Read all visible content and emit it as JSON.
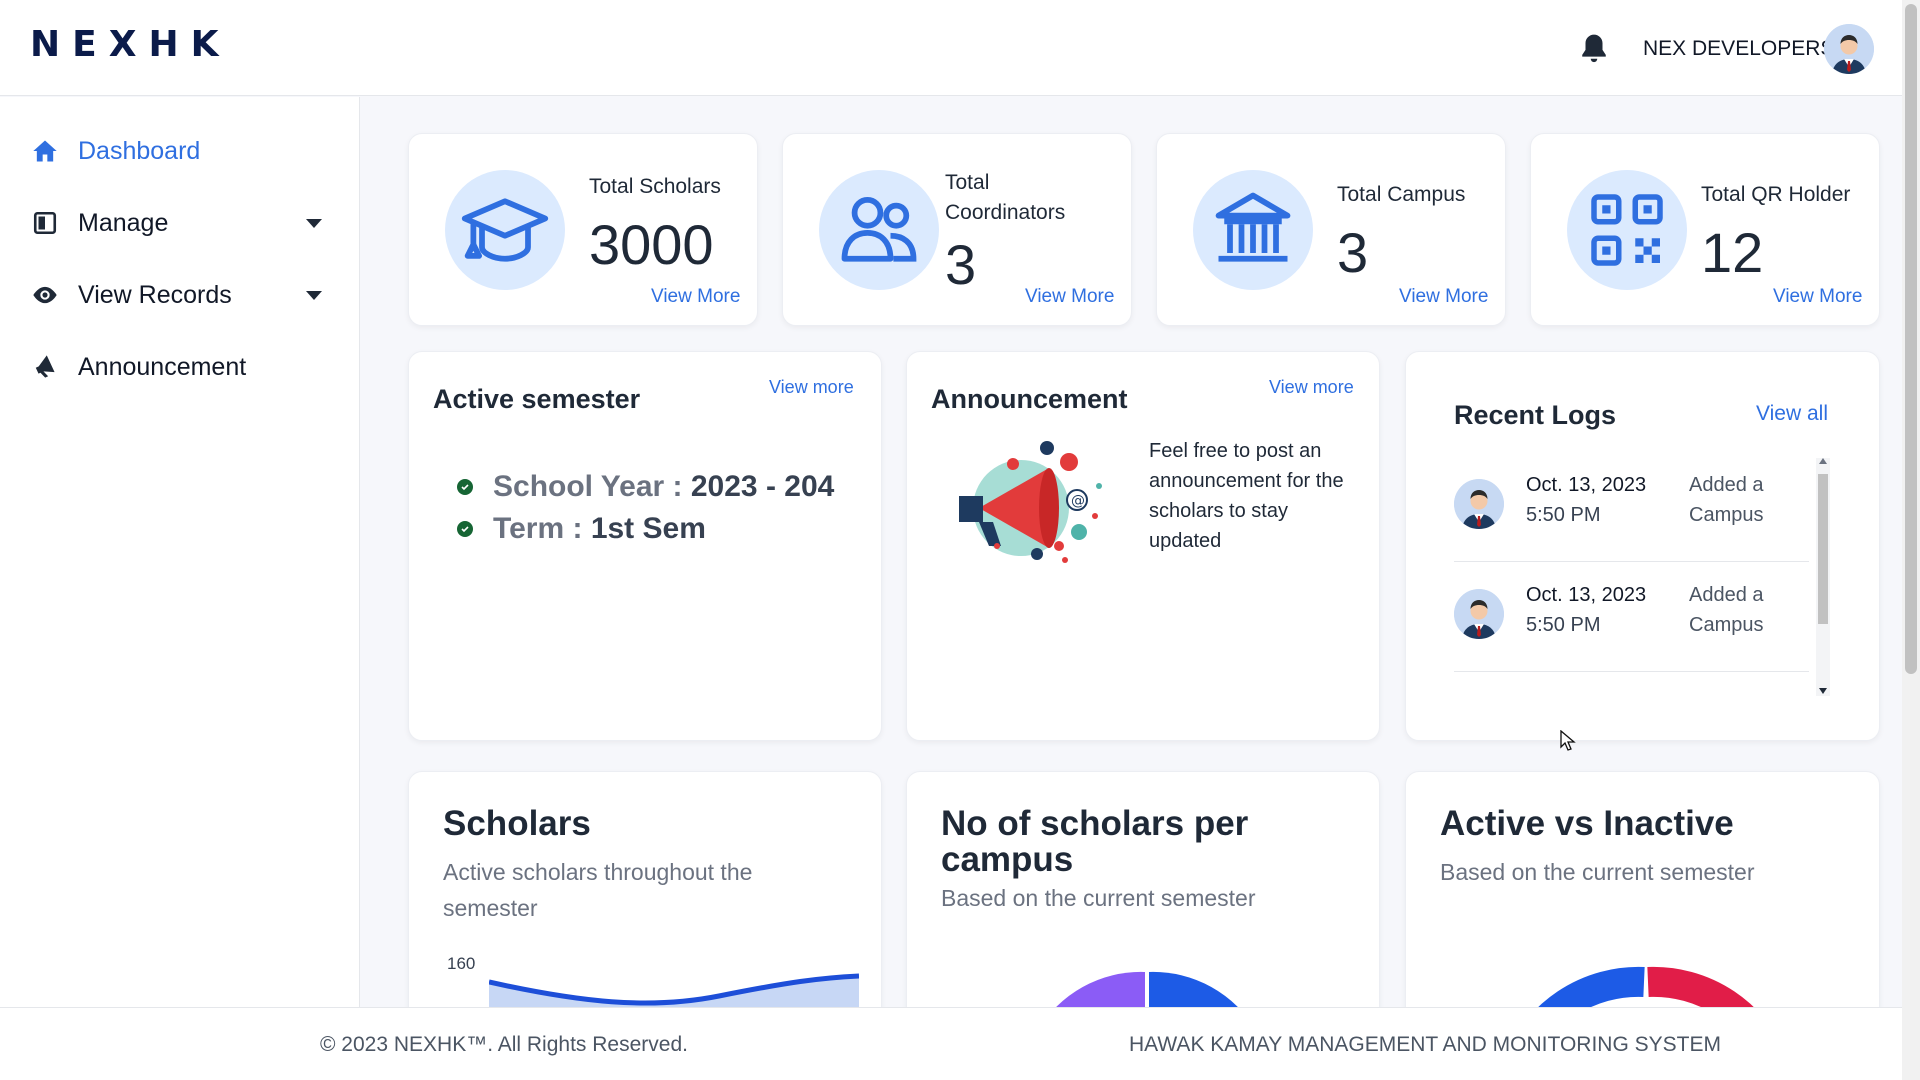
{
  "brand": {
    "logo": "NEXHK"
  },
  "header": {
    "user_name": "NEX DEVELOPERS"
  },
  "sidebar": {
    "items": [
      {
        "label": "Dashboard",
        "icon": "home-icon",
        "active": true
      },
      {
        "label": "Manage",
        "icon": "board-icon",
        "has_dropdown": true
      },
      {
        "label": "View Records",
        "icon": "eye-icon",
        "has_dropdown": true
      },
      {
        "label": "Announcement",
        "icon": "megaphone-icon"
      }
    ]
  },
  "stats": [
    {
      "label": "Total Scholars",
      "value": "3000",
      "link": "View More",
      "icon": "graduation-cap-icon"
    },
    {
      "label": "Total Coordinators",
      "value": "3",
      "link": "View More",
      "icon": "users-icon"
    },
    {
      "label": "Total Campus",
      "value": "3",
      "link": "View More",
      "icon": "building-icon"
    },
    {
      "label": "Total QR Holder",
      "value": "12",
      "link": "View More",
      "icon": "qr-code-icon"
    }
  ],
  "semester": {
    "title": "Active semester",
    "link": "View more",
    "school_year_label": "School Year :",
    "school_year_value": "2023 - 204",
    "term_label": "Term :",
    "term_value": "1st Sem"
  },
  "announcement": {
    "title": "Announcement",
    "link": "View more",
    "text": "Feel free to post an announcement for the scholars to stay updated",
    "image": "megaphone-illustration"
  },
  "logs": {
    "title": "Recent Logs",
    "link": "View all",
    "items": [
      {
        "date": "Oct. 13, 2023",
        "time": "5:50 PM",
        "action": "Added a Campus"
      },
      {
        "date": "Oct. 13, 2023",
        "time": "5:50 PM",
        "action": "Added a Campus"
      }
    ]
  },
  "charts": {
    "scholars": {
      "title": "Scholars",
      "subtitle": "Active scholars throughout the semester",
      "tick": "160"
    },
    "per_campus": {
      "title": "No of scholars per campus",
      "subtitle": "Based on the current semester"
    },
    "active_inactive": {
      "title": "Active vs Inactive",
      "subtitle": "Based on the current semester"
    }
  },
  "footer": {
    "copyright": "© 2023 NEXHK™. All Rights Reserved.",
    "system_name": "HAWAK KAMAY MANAGEMENT AND MONITORING SYSTEM"
  },
  "colors": {
    "accent": "#2f6fe0",
    "icon_bg": "#dbeafe",
    "check": "#166534",
    "donut_red": "#e11d48",
    "donut_purple": "#8b5cf6"
  }
}
